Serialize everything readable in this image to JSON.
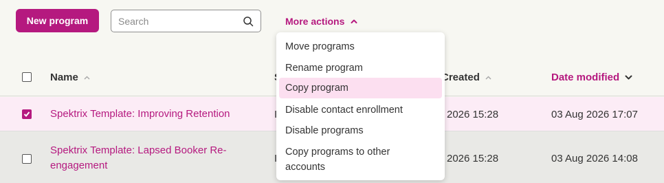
{
  "toolbar": {
    "new_program_label": "New program",
    "search_placeholder": "Search",
    "more_actions_label": "More actions"
  },
  "table": {
    "columns": {
      "name": "Name",
      "status_partial": "S",
      "created": "Created",
      "date_modified": "Date modified"
    },
    "rows": [
      {
        "name": "Spektrix Template: Improving Retention",
        "created": "2026 15:28",
        "modified": "03 Aug 2026 17:07",
        "checked": true,
        "status_partial": "I"
      },
      {
        "name": "Spektrix Template: Lapsed Booker Re-engagement",
        "created": "2026 15:28",
        "modified": "03 Aug 2026 14:08",
        "checked": false,
        "status_partial": "I"
      }
    ]
  },
  "dropdown": {
    "items": [
      "Move programs",
      "Rename program",
      "Copy program",
      "Disable contact enrollment",
      "Disable programs",
      "Copy programs to other accounts"
    ],
    "highlighted": "Copy program"
  },
  "colors": {
    "brand": "#b5197f",
    "highlight_row": "#fcecf6",
    "highlight_menu": "#fcdff0"
  }
}
